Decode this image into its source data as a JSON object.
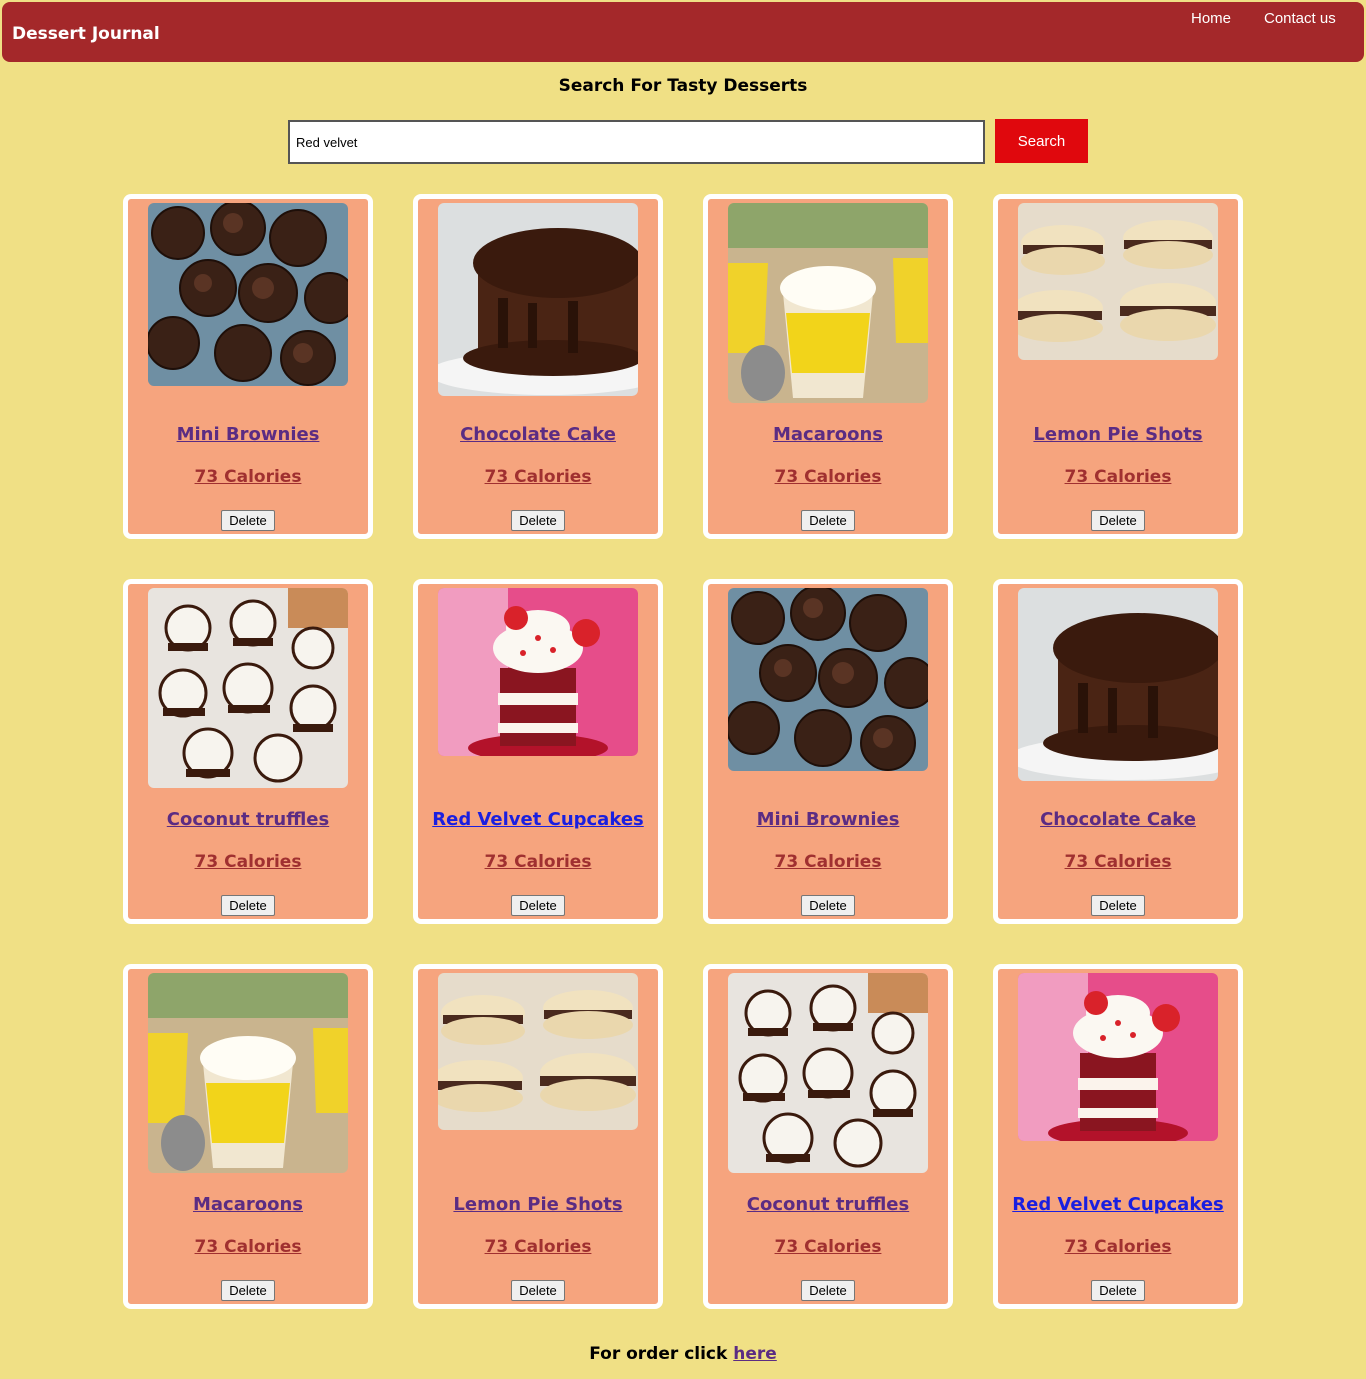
{
  "navbar": {
    "brand": "Dessert Journal",
    "links": [
      "Home",
      "Contact us"
    ]
  },
  "search": {
    "heading": "Search For Tasty Desserts",
    "value": "Red velvet",
    "button_label": "Search"
  },
  "cards": [
    {
      "title": "Mini Brownies",
      "calories": "73 Calories",
      "delete_label": "Delete",
      "image": "brownies"
    },
    {
      "title": "Chocolate Cake",
      "calories": "73 Calories",
      "delete_label": "Delete",
      "image": "chocolate-cake"
    },
    {
      "title": "Macaroons",
      "calories": "73 Calories",
      "delete_label": "Delete",
      "image": "lemon-cups"
    },
    {
      "title": "Lemon Pie Shots",
      "calories": "73 Calories",
      "delete_label": "Delete",
      "image": "macarons"
    },
    {
      "title": "Coconut truffles",
      "calories": "73 Calories",
      "delete_label": "Delete",
      "image": "coconut-truffles"
    },
    {
      "title": "Red Velvet Cupcakes",
      "calories": "73 Calories",
      "delete_label": "Delete",
      "image": "red-velvet"
    },
    {
      "title": "Mini Brownies",
      "calories": "73 Calories",
      "delete_label": "Delete",
      "image": "brownies"
    },
    {
      "title": "Chocolate Cake",
      "calories": "73 Calories",
      "delete_label": "Delete",
      "image": "chocolate-cake"
    },
    {
      "title": "Macaroons",
      "calories": "73 Calories",
      "delete_label": "Delete",
      "image": "lemon-cups"
    },
    {
      "title": "Lemon Pie Shots",
      "calories": "73 Calories",
      "delete_label": "Delete",
      "image": "macarons"
    },
    {
      "title": "Coconut truffles",
      "calories": "73 Calories",
      "delete_label": "Delete",
      "image": "coconut-truffles"
    },
    {
      "title": "Red Velvet Cupcakes",
      "calories": "73 Calories",
      "delete_label": "Delete",
      "image": "red-velvet"
    }
  ],
  "footer": {
    "text": "For order click",
    "link": "here"
  },
  "colors": {
    "page_background": "#f0e085",
    "navbar": "#a4282a",
    "card_background": "#f6a47e",
    "search_button": "#e0080d",
    "visited_link": "#5b2c83",
    "unvisited_link": "#1a1fe0",
    "calories_link": "#a03030"
  }
}
